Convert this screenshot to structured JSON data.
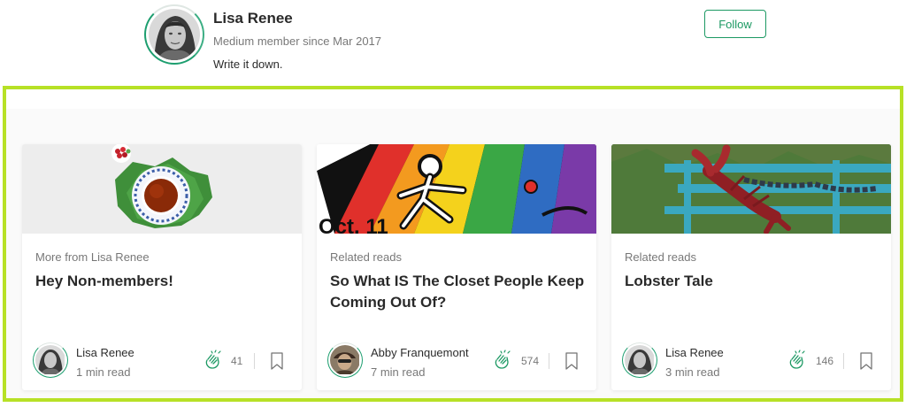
{
  "author": {
    "name": "Lisa Renee",
    "member_since": "Medium member since Mar 2017",
    "bio": "Write it down.",
    "follow_label": "Follow"
  },
  "colors": {
    "accent_green": "#1c9963",
    "highlight": "#b7e126"
  },
  "cards": [
    {
      "image": "tea-cup-on-leaves",
      "kicker": "More from Lisa Renee",
      "title": "Hey Non-members!",
      "author": "Lisa Renee",
      "read_time": "1 min read",
      "claps": "41",
      "clap_icon": "clap-icon",
      "bookmark_icon": "bookmark-icon"
    },
    {
      "image": "rainbow-closet-graphic",
      "kicker": "Related reads",
      "title": "So What IS The Closet People Keep Coming Out Of?",
      "author": "Abby Franquemont",
      "read_time": "7 min read",
      "claps": "574",
      "clap_icon": "clap-icon",
      "bookmark_icon": "bookmark-icon"
    },
    {
      "image": "lobster-on-trap",
      "kicker": "Related reads",
      "title": "Lobster Tale",
      "author": "Lisa Renee",
      "read_time": "3 min read",
      "claps": "146",
      "clap_icon": "clap-icon",
      "bookmark_icon": "bookmark-icon"
    }
  ]
}
